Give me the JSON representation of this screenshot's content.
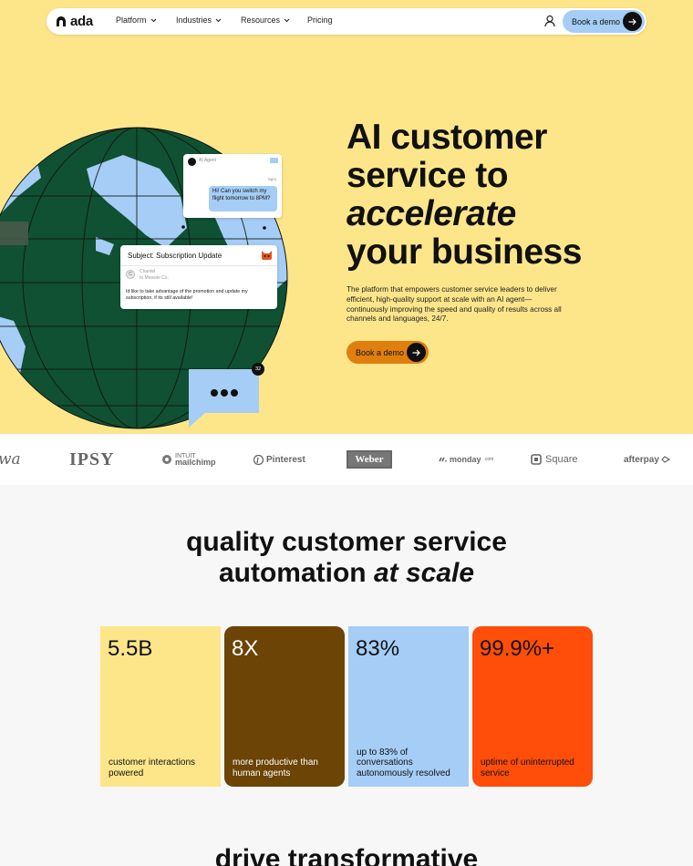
{
  "nav": {
    "logo": "ada",
    "items": [
      "Platform",
      "Industries",
      "Resources",
      "Pricing"
    ],
    "cta": "Book a demo"
  },
  "hero": {
    "title_line1": "AI customer",
    "title_line2": "service to",
    "title_line3": "accelerate",
    "title_line4": "your business",
    "subtitle": "The platform that empowers customer service leaders to deliver efficient, high-quality support at scale with an AI agent—continuously improving the speed and quality of results across all channels and languages, 24/7.",
    "cta": "Book a demo"
  },
  "chat_card1": {
    "agent": "AI Agent",
    "time": "5pm",
    "message": "Hi! Can you switch my flight tomorrow to 8PM?"
  },
  "chat_card2": {
    "subject": "Subject: Subscription Update",
    "avatar_initial": "C",
    "sender_name": "Chantel",
    "sender_to": "to Meowie Co.",
    "message": "Id like to take advantage of the promotion and update my subscription, if its still available!"
  },
  "notification_count": "32",
  "logos": {
    "wa": "wa",
    "ipsy": "IPSY",
    "mailchimp_top": "INTUIT",
    "mailchimp": "mailchimp",
    "pinterest": "Pinterest",
    "weber": "Weber",
    "monday": "monday",
    "monday_suffix": ".com",
    "square": "Square",
    "afterpay": "afterpay"
  },
  "stats": {
    "title_line1": "quality customer service",
    "title_line2_prefix": "automation ",
    "title_line2_italic": "at scale",
    "cards": [
      {
        "value": "5.5B",
        "label": "customer interactions powered",
        "color": "#fde68a"
      },
      {
        "value": "8X",
        "label": "more productive than human agents",
        "color": "#6b4406"
      },
      {
        "value": "83%",
        "label": "up to 83% of conversations autonomously resolved",
        "color": "#a5cdf5"
      },
      {
        "value": "99.9%+",
        "label": "uptime of uninterrupted service",
        "color": "#ff4d0a"
      }
    ]
  },
  "next_section_title": "drive transformative",
  "colors": {
    "hero_bg": "#fde68a",
    "globe_green": "#0f5132",
    "land_blue": "#a5cdf5",
    "accent_orange": "#e07f0e",
    "accent_red": "#ff4d0a"
  }
}
